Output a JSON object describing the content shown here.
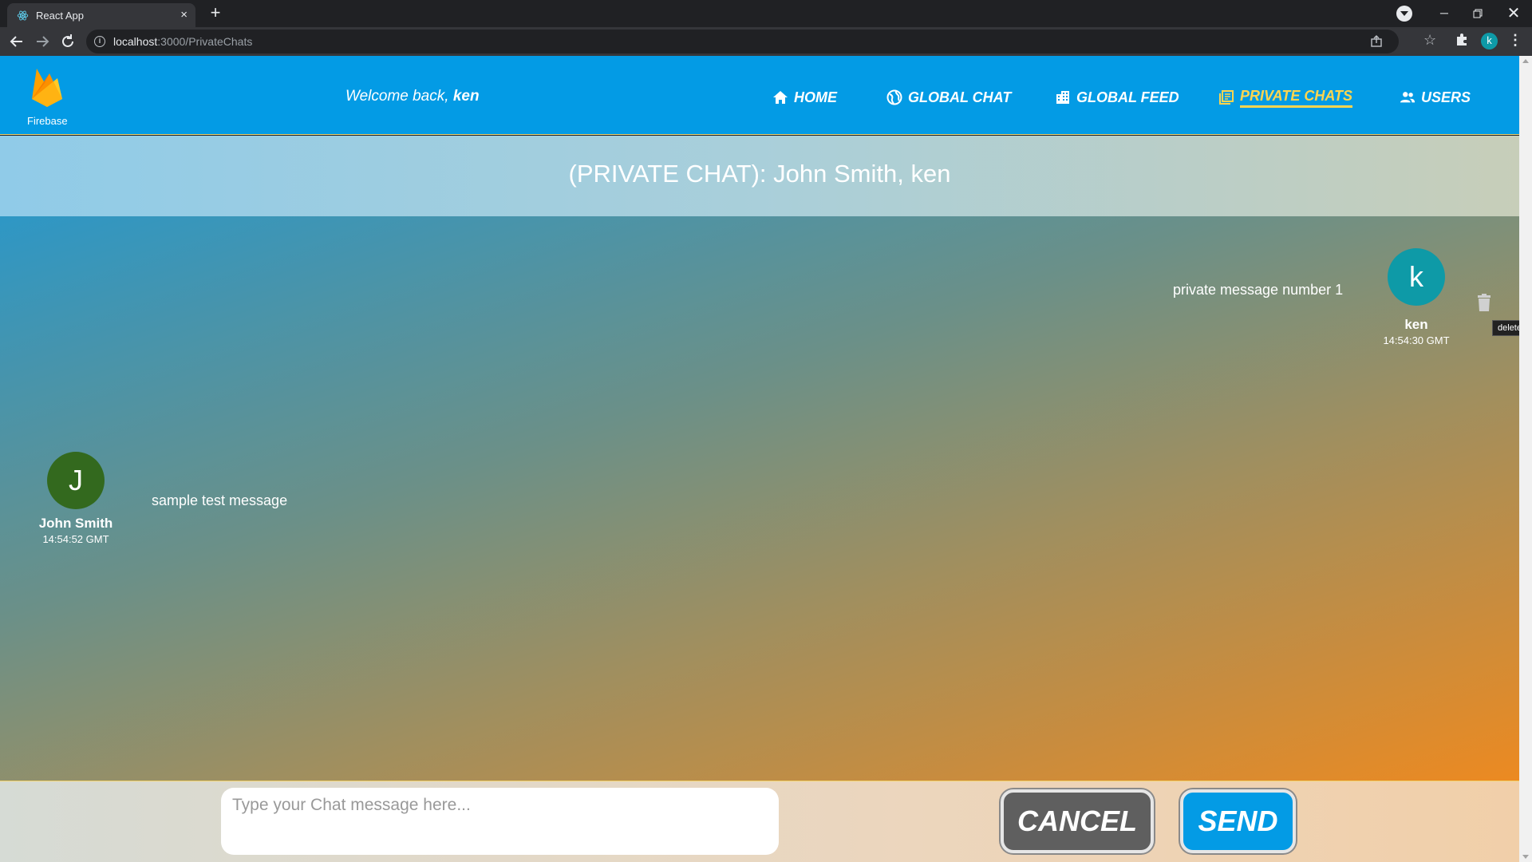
{
  "browser": {
    "tab_title": "React App",
    "tab_close": "×",
    "new_tab": "+",
    "url_host": "localhost",
    "url_path": ":3000/PrivateChats",
    "profile_initial": "k",
    "win_min": "─",
    "win_close": "✕",
    "kebab": "⋮",
    "star": "☆",
    "info": "i"
  },
  "navbar": {
    "logo_label": "Firebase",
    "welcome_prefix": "Welcome back, ",
    "welcome_name": "ken",
    "links": {
      "home": "HOME",
      "global_chat": "GLOBAL CHAT",
      "global_feed": "GLOBAL FEED",
      "private_chats": "PRIVATE CHATS",
      "users": "USERS"
    },
    "active_link": "private_chats",
    "colors": {
      "bar": "#039be5",
      "active": "#ffd54f"
    }
  },
  "chat": {
    "title": "(PRIVATE CHAT): John Smith, ken",
    "messages": [
      {
        "initial": "k",
        "user": "ken",
        "time": "14:54:30 GMT",
        "text": "private message number 1",
        "avatar_color": "#0e9aa7",
        "side": "right"
      },
      {
        "initial": "J",
        "user": "John Smith",
        "time": "14:54:52 GMT",
        "text": "sample test message",
        "avatar_color": "#33691e",
        "side": "left"
      }
    ],
    "delete_tooltip": "delete"
  },
  "composer": {
    "placeholder": "Type your Chat message here...",
    "value": "",
    "cancel_label": "CANCEL",
    "send_label": "SEND"
  }
}
